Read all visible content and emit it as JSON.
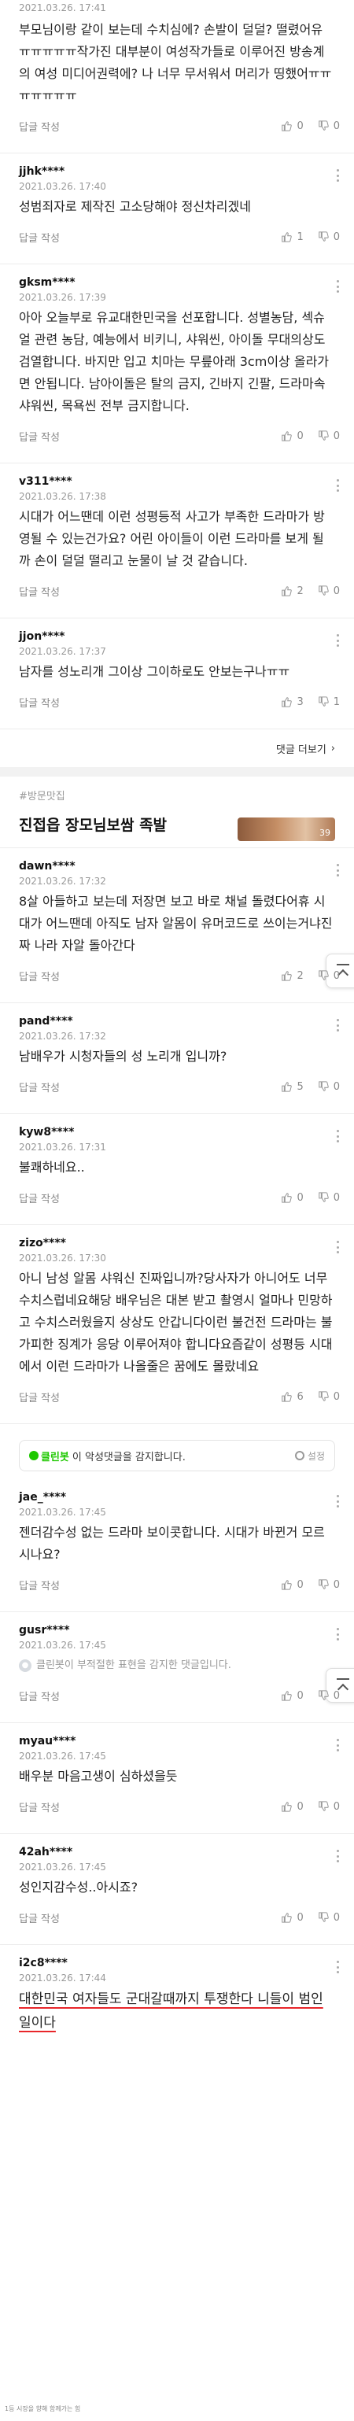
{
  "top_fragment": {
    "date": "2021.03.26. 17:41",
    "text": "부모님이랑 같이 보는데 수치심에? 손발이 덜덜? 떨렸어유ㅠㅠㅠㅠㅠ작가진 대부분이 여성작가들로 이루어진 방송계의 여성 미디어권력에? 나 너무 무서워서 머리가 띵했어ㅠㅠㅠㅠㅠㅠㅠ",
    "reply": "답글 작성",
    "up": "0",
    "down": "0"
  },
  "comments1": [
    {
      "user": "jjhk****",
      "date": "2021.03.26. 17:40",
      "text": "성범죄자로 제작진 고소당해야 정신차리겠네",
      "reply": "답글 작성",
      "up": "1",
      "down": "0"
    },
    {
      "user": "gksm****",
      "date": "2021.03.26. 17:39",
      "text": "아아 오늘부로 유교대한민국을 선포합니다. 성별농담, 섹슈얼 관련 농담, 예능에서 비키니, 샤워씬, 아이돌 무대의상도 검열합니다. 바지만 입고 치마는 무릎아래 3cm이상 올라가면 안됩니다. 남아이돌은 탈의 금지, 긴바지 긴팔, 드라마속 샤워씬, 목욕씬 전부 금지합니다.",
      "reply": "답글 작성",
      "up": "0",
      "down": "0"
    },
    {
      "user": "v311****",
      "date": "2021.03.26. 17:38",
      "text": "시대가 어느땐데 이런 성평등적 사고가 부족한 드라마가 방영될 수 있는건가요? 어린 아이들이 이런 드라마를 보게 될까 손이 덜덜 떨리고 눈물이 날 것 같습니다.",
      "reply": "답글 작성",
      "up": "2",
      "down": "0"
    },
    {
      "user": "jjon****",
      "date": "2021.03.26. 17:37",
      "text": "남자를 성노리개 그이상 그이하로도 안보는구나ㅠㅠ",
      "reply": "답글 작성",
      "up": "3",
      "down": "1"
    }
  ],
  "more_comments_label": "댓글 더보기",
  "section": {
    "hashtag": "#방문맛집",
    "title": "진접읍 장모님보쌈 족발",
    "thumb_count": "39"
  },
  "comments2": [
    {
      "user": "dawn****",
      "date": "2021.03.26. 17:32",
      "text": "8살 아들하고 보는데 저장면 보고 바로 채널 돌렸다어휴 시대가 어느땐데 아직도 남자 알몸이 유머코드로 쓰이는거냐진짜 나라 자알 돌아간다",
      "reply": "답글 작성",
      "up": "2",
      "down": "0"
    },
    {
      "user": "pand****",
      "date": "2021.03.26. 17:32",
      "text": "남배우가 시청자들의 성 노리개 입니까?",
      "reply": "답글 작성",
      "up": "5",
      "down": "0"
    },
    {
      "user": "kyw8****",
      "date": "2021.03.26. 17:31",
      "text": "불쾌하네요..",
      "reply": "답글 작성",
      "up": "0",
      "down": "0"
    },
    {
      "user": "zizo****",
      "date": "2021.03.26. 17:30",
      "text": "아니 남성 알몸 샤워신 진짜입니까?당사자가 아니어도 너무 수치스럽네요해당 배우님은 대본 받고 촬영시 얼마나 민망하고 수치스러웠을지 상상도 안갑니다이런 불건전 드라마는 불가피한 징계가 응당 이루어져야 합니다요즘같이 성평등 시대에서 이런 드라마가 나올줄은 꿈에도 몰랐네요",
      "reply": "답글 작성",
      "up": "6",
      "down": "0"
    }
  ],
  "cleanbot": {
    "name": "클린봇",
    "text": "이 악성댓글을 감지합니다.",
    "settings": "설정"
  },
  "comments3": [
    {
      "user": "jae_****",
      "date": "2021.03.26. 17:45",
      "text": "젠더감수성 없는 드라마 보이콧합니다. 시대가 바뀐거 모르시나요?",
      "reply": "답글 작성",
      "up": "0",
      "down": "0"
    }
  ],
  "gusr": {
    "user": "gusr****",
    "date": "2021.03.26. 17:45",
    "text": "클린봇이 부적절한 표현을 감지한 댓글입니다.",
    "reply": "답글 작성",
    "up": "0",
    "down": "0"
  },
  "comments4": [
    {
      "user": "myau****",
      "date": "2021.03.26. 17:45",
      "text": "배우분 마음고생이 심하셨을듯",
      "reply": "답글 작성",
      "up": "0",
      "down": "0"
    },
    {
      "user": "42ah****",
      "date": "2021.03.26. 17:45",
      "text": "성인지감수성..아시죠?",
      "reply": "답글 작성",
      "up": "0",
      "down": "0"
    }
  ],
  "last": {
    "user": "i2c8****",
    "date": "2021.03.26. 17:44",
    "text": "대한민국 여자들도 군대갈때까지 투쟁한다 니들이 범인일이다"
  },
  "watermark": "1등 시장을 향해 함께가는 힘"
}
